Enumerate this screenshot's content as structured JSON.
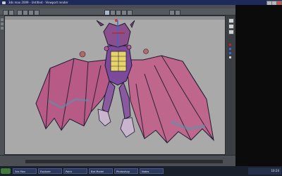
{
  "window": {
    "title": "3ds max 2009 - Untitled - Viewport render"
  },
  "taskbar": {
    "tasks": [
      {
        "label": "3ds Max"
      },
      {
        "label": "Explorer"
      },
      {
        "label": "Paint"
      },
      {
        "label": "Bat Model"
      },
      {
        "label": "Photoshop"
      },
      {
        "label": "Notes"
      }
    ],
    "clock": "10:24"
  },
  "colors": {
    "viewport_bg": "#a9a9a9",
    "wing_membrane": "#b85a86",
    "body": "#7b4a9a",
    "outline": "#1f1a2e",
    "accent_red": "#b42a2a",
    "accent_blue": "#3f66c8"
  },
  "icons": [
    "window-icon",
    "minimize-icon",
    "maximize-icon",
    "close-icon",
    "start-icon"
  ]
}
